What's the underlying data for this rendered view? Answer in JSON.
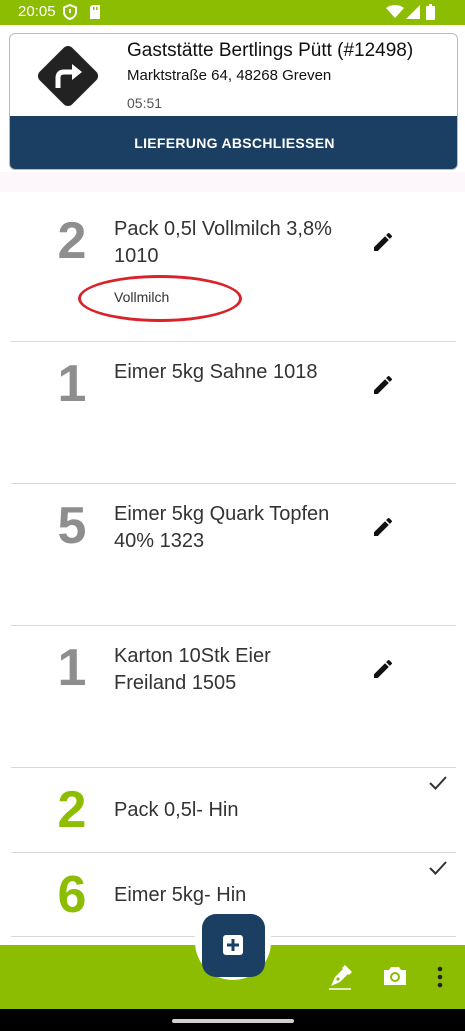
{
  "status_bar": {
    "time": "20:05",
    "left_icons": [
      "vpn-shield-icon",
      "sd-card-icon"
    ],
    "right_icons": [
      "wifi-icon",
      "signal-icon",
      "battery-icon"
    ]
  },
  "delivery": {
    "route_icon": "turn-right-sign-icon",
    "customer": "Gaststätte Bertlings Pütt (#12498)",
    "address": "Marktstraße 64, 48268 Greven",
    "eta": "05:51",
    "finish_label": "LIEFERUNG ABSCHLIESSEN"
  },
  "items": [
    {
      "qty": "2",
      "name": "Pack 0,5l Vollmilch 3,8% 1010",
      "note": "Vollmilch",
      "action": "edit-icon"
    },
    {
      "qty": "1",
      "name": "Eimer 5kg Sahne 1018",
      "action": "edit-icon"
    },
    {
      "qty": "5",
      "name": "Eimer 5kg Quark Topfen 40% 1323",
      "action": "edit-icon"
    },
    {
      "qty": "1",
      "name": "Karton 10Stk Eier Freiland 1505",
      "action": "edit-icon"
    },
    {
      "qty": "2",
      "name": "Pack 0,5l- Hin",
      "action": "check-icon"
    },
    {
      "qty": "6",
      "name": "Eimer 5kg- Hin",
      "action": "check-icon"
    }
  ],
  "bottom_bar": {
    "fab_icon": "add-item-icon",
    "actions": [
      "signature-pen-icon",
      "camera-icon",
      "more-vertical-icon"
    ]
  },
  "colors": {
    "accent_green": "#8cbd00",
    "navy": "#1b3f63",
    "note_highlight": "#d8232a"
  }
}
